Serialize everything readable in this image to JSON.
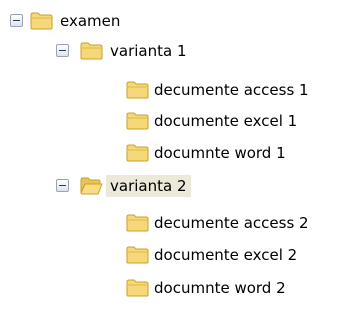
{
  "tree": {
    "root": {
      "label": "examen",
      "expanded": true,
      "children": [
        {
          "label": "varianta 1",
          "expanded": true,
          "children": [
            {
              "label": "decumente access 1"
            },
            {
              "label": "documente excel 1"
            },
            {
              "label": "documnte word 1"
            }
          ]
        },
        {
          "label": "varianta 2",
          "expanded": true,
          "selected": true,
          "children": [
            {
              "label": "decumente access 2"
            },
            {
              "label": "documente excel 2"
            },
            {
              "label": "documnte word 2"
            }
          ]
        }
      ]
    }
  },
  "colors": {
    "selection_highlight": "#ece9d8",
    "folder_fill": "#f6d77a",
    "folder_outline": "#c9a227",
    "expander_border": "#9aa3b2"
  },
  "icons": {
    "expander": "minus-box-icon",
    "closed_folder": "folder-icon",
    "open_folder": "open-folder-icon"
  }
}
